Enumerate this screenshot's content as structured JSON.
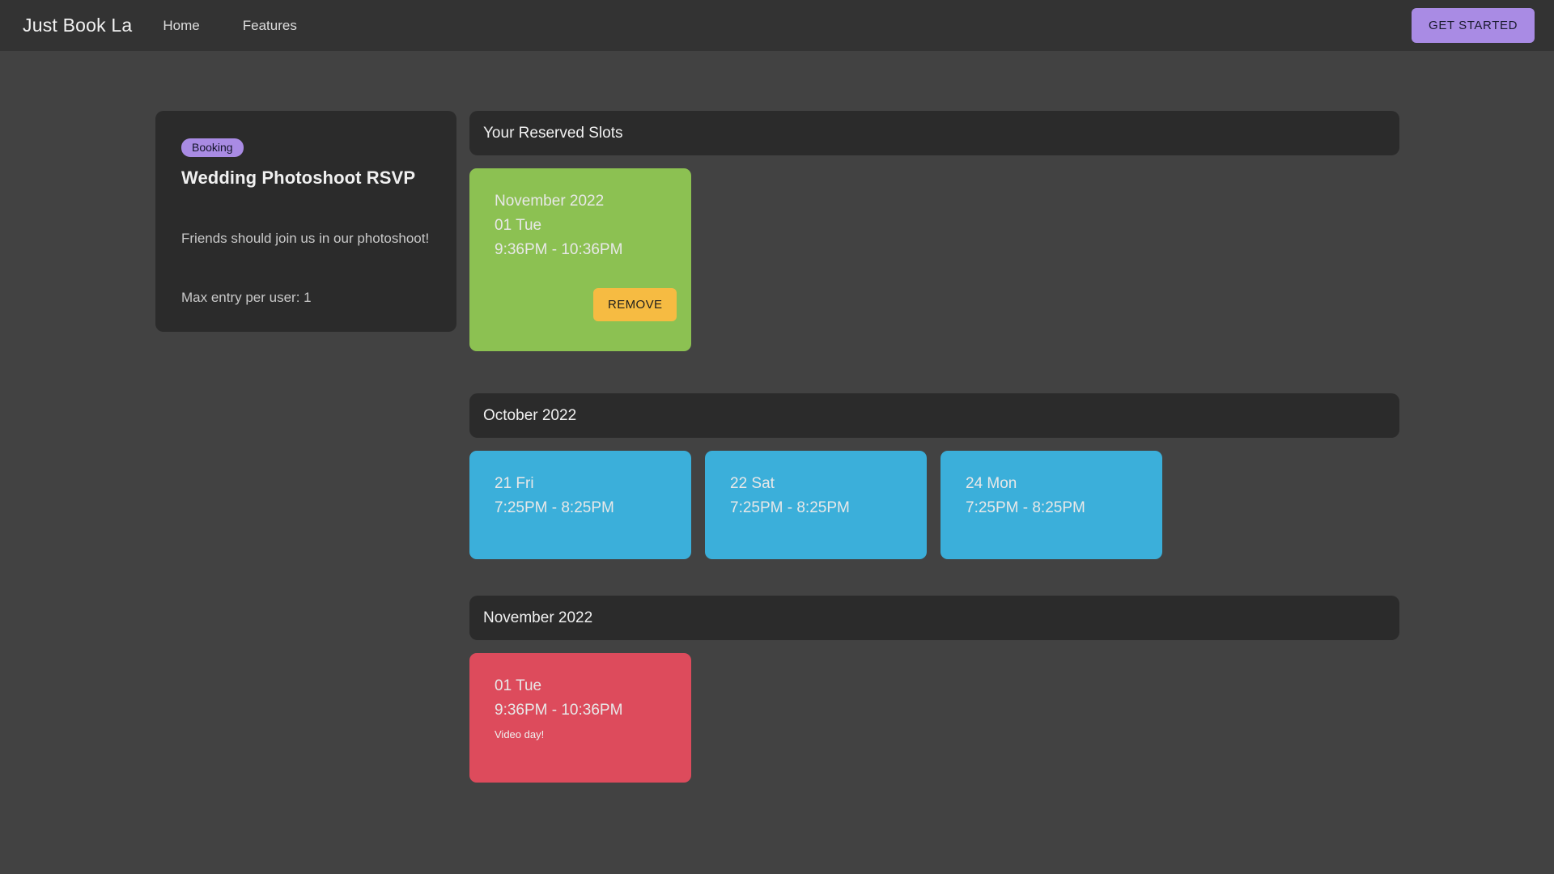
{
  "navbar": {
    "brand": "Just Book La",
    "links": [
      {
        "label": "Home"
      },
      {
        "label": "Features"
      }
    ],
    "cta_label": "GET STARTED",
    "background": "#333333",
    "accent": "#a98be4"
  },
  "info_card": {
    "badge": "Booking",
    "title": "Wedding Photoshoot RSVP",
    "description": "Friends should join us in our photoshoot!",
    "max_entry": "Max entry per user: 1"
  },
  "sections": [
    {
      "header": "Your Reserved Slots",
      "color": "#8cc152",
      "slots": [
        {
          "month": "November 2022",
          "day": "01 Tue",
          "time": "9:36PM - 10:36PM",
          "action_label": "REMOVE",
          "action_color": "#f6bb42"
        }
      ]
    },
    {
      "header": "October 2022",
      "color": "#3bafda",
      "slots": [
        {
          "day": "21 Fri",
          "time": "7:25PM - 8:25PM"
        },
        {
          "day": "22 Sat",
          "time": "7:25PM - 8:25PM"
        },
        {
          "day": "24 Mon",
          "time": "7:25PM - 8:25PM"
        }
      ]
    },
    {
      "header": "November 2022",
      "color": "#dd4b5c",
      "slots": [
        {
          "day": "01 Tue",
          "time": "9:36PM - 10:36PM",
          "note": "Video day!"
        }
      ]
    }
  ]
}
